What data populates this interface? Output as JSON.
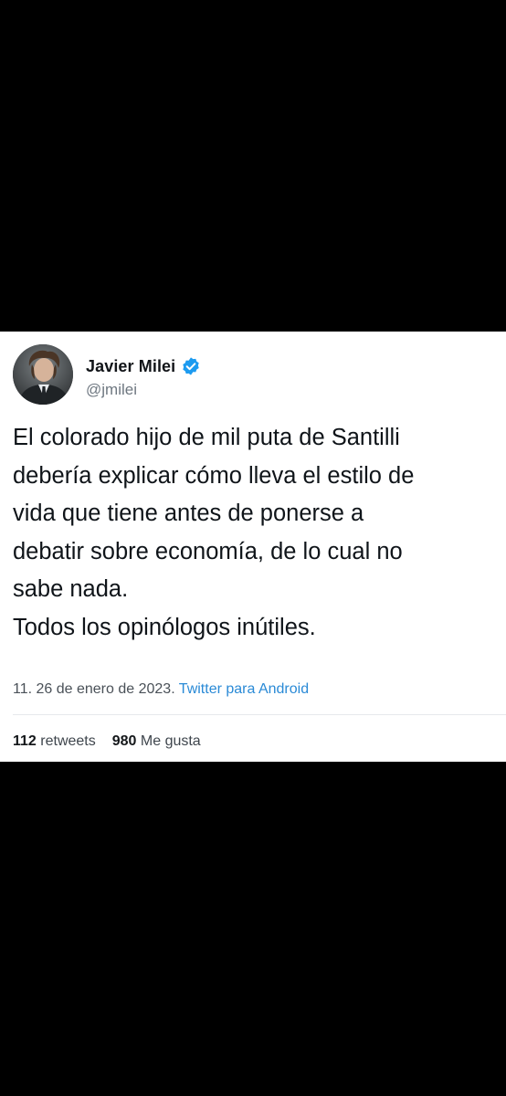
{
  "tweet": {
    "author": {
      "display_name": "Javier Milei",
      "handle": "@jmilei",
      "verified": true
    },
    "text": "El colorado hijo de mil puta de Santilli\ndebería explicar cómo lleva el estilo de\nvida que tiene antes de ponerse a\ndebatir sobre economía, de lo cual no\nsabe nada.\nTodos los opinólogos inútiles.",
    "timestamp": "11. 26 de enero de 2023.",
    "source": "Twitter para Android",
    "stats": {
      "retweets_count": "112",
      "retweets_label": "retweets",
      "likes_count": "980",
      "likes_label": "Me gusta"
    }
  },
  "colors": {
    "background": "#000000",
    "card": "#ffffff",
    "verified_badge": "#1d9bf0",
    "source_link": "#2a8ad6"
  },
  "icons": {
    "verified": "verified-badge-icon",
    "avatar": "profile-photo"
  }
}
